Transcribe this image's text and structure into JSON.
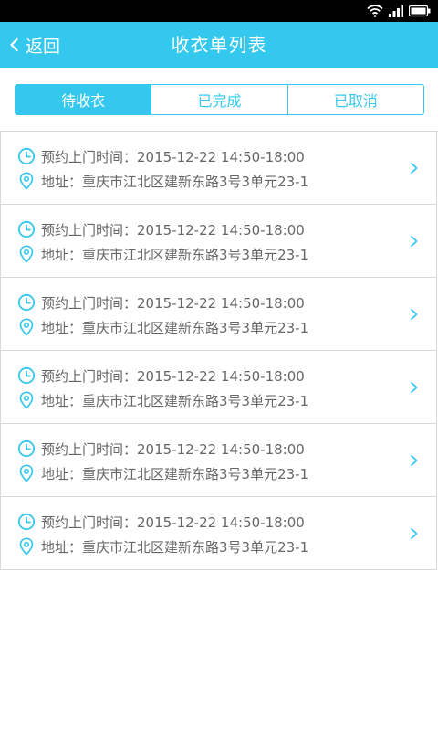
{
  "header": {
    "back_label": "返回",
    "title": "收衣单列表"
  },
  "tabs": [
    {
      "label": "待收衣",
      "active": true
    },
    {
      "label": "已完成",
      "active": false
    },
    {
      "label": "已取消",
      "active": false
    }
  ],
  "orders": [
    {
      "time": "预约上门时间：2015-12-22 14:50-18:00",
      "address": "地址：重庆市江北区建新东路3号3单元23-1"
    },
    {
      "time": "预约上门时间：2015-12-22 14:50-18:00",
      "address": "地址：重庆市江北区建新东路3号3单元23-1"
    },
    {
      "time": "预约上门时间：2015-12-22 14:50-18:00",
      "address": "地址：重庆市江北区建新东路3号3单元23-1"
    },
    {
      "time": "预约上门时间：2015-12-22 14:50-18:00",
      "address": "地址：重庆市江北区建新东路3号3单元23-1"
    },
    {
      "time": "预约上门时间：2015-12-22 14:50-18:00",
      "address": "地址：重庆市江北区建新东路3号3单元23-1"
    },
    {
      "time": "预约上门时间：2015-12-22 14:50-18:00",
      "address": "地址：重庆市江北区建新东路3号3单元23-1"
    }
  ],
  "colors": {
    "accent": "#35C8EE",
    "text": "#666666",
    "divider": "#d8d8d8"
  },
  "icons": {
    "time": "clock-icon",
    "address": "location-pin-icon",
    "detail": "chevron-right-icon"
  }
}
